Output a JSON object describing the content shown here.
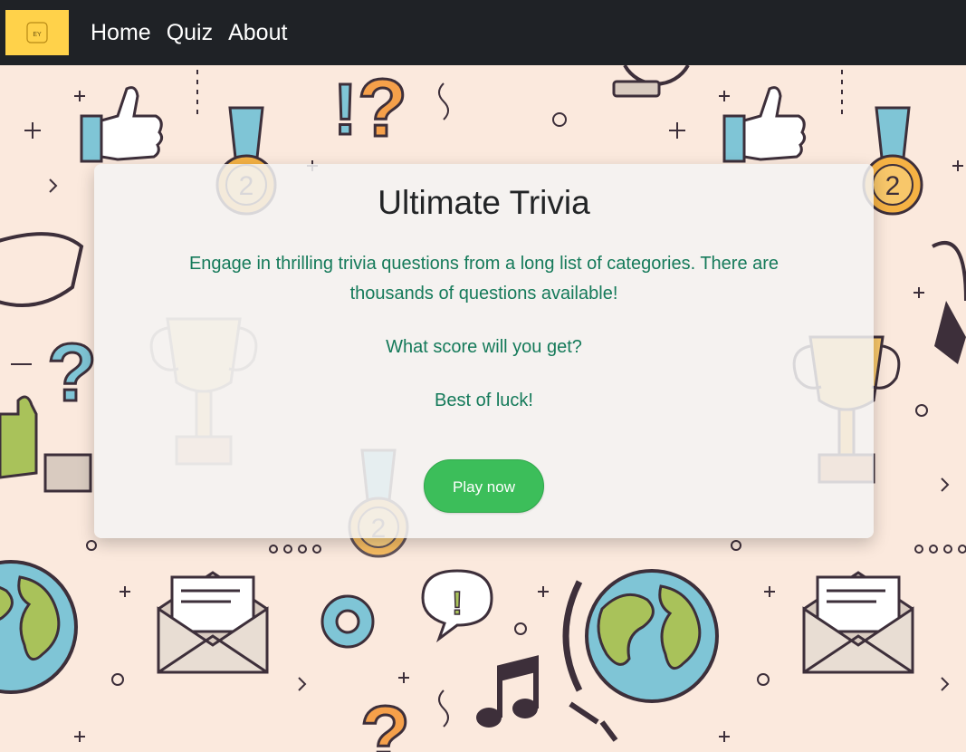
{
  "navbar": {
    "logo_text": "EY",
    "links": [
      "Home",
      "Quiz",
      "About"
    ]
  },
  "card": {
    "title": "Ultimate Trivia",
    "description": "Engage in thrilling trivia questions from a long list of categories. There are thousands of questions available!",
    "question": "What score will you get?",
    "wish": "Best of luck!",
    "play_label": "Play now"
  },
  "colors": {
    "navbar_bg": "#1f2226",
    "logo_bg": "#ffd24a",
    "page_bg": "#fbe9dd",
    "accent_text": "#157a5a",
    "play_button": "#3cbe5a"
  },
  "icons": [
    "thumbs-up-icon",
    "medal-icon",
    "question-mark-icon",
    "exclamation-icon",
    "lightbulb-icon",
    "magnifier-icon",
    "glasses-icon",
    "trophy-icon",
    "puzzle-piece-icon",
    "globe-icon",
    "envelope-icon",
    "gear-icon",
    "music-note-icon",
    "speech-bubble-icon",
    "play-button-icon",
    "star-icon",
    "pencil-icon"
  ]
}
